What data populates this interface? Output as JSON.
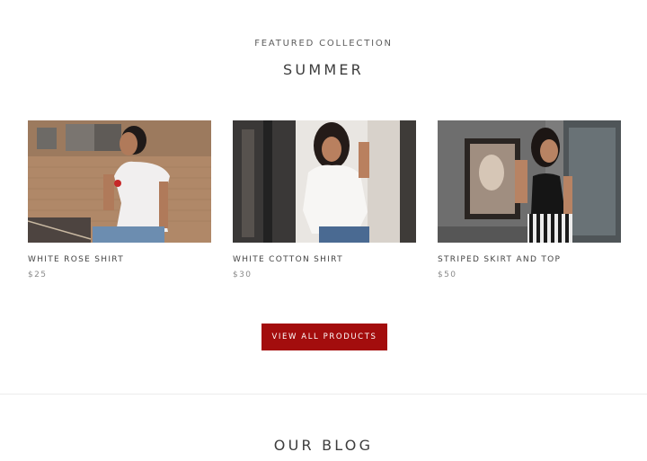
{
  "featured": {
    "eyebrow": "FEATURED COLLECTION",
    "title": "SUMMER"
  },
  "products": [
    {
      "name": "WHITE ROSE SHIRT",
      "price": "$25",
      "image": "woman-in-white-rose-tshirt-photo"
    },
    {
      "name": "WHITE COTTON SHIRT",
      "price": "$30",
      "image": "woman-in-white-cotton-shirt-photo"
    },
    {
      "name": "STRIPED SKIRT AND TOP",
      "price": "$50",
      "image": "woman-in-black-top-striped-skirt-photo"
    }
  ],
  "cta": {
    "label": "VIEW ALL PRODUCTS"
  },
  "blog": {
    "title": "OUR BLOG"
  },
  "colors": {
    "accent": "#a30d0d",
    "text": "#3d3d3d",
    "muted": "#8a8a8a"
  }
}
